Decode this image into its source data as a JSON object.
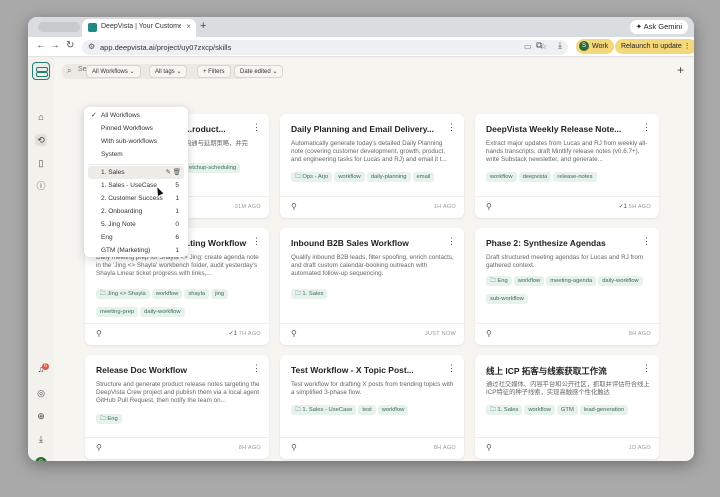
{
  "browser": {
    "tab_title": "DeepVista | Your Customer P...",
    "tab_close": "×",
    "new_tab": "+",
    "ask_gemini": "✦ Ask Gemini",
    "url": "app.deepvista.ai/project/uy07zxcp/skills",
    "profile_initial": "S",
    "profile_label": "Work",
    "relaunch": "Relaunch to update ⋮"
  },
  "sidebar": {
    "notifications_count": "6",
    "user_initial": "S"
  },
  "search": {
    "placeholder": "Search workflows..."
  },
  "filters": {
    "workflows": "All Workflows ⌄",
    "tags": "All tags ⌄",
    "add_filters": "+ Filters",
    "sort": "Date edited ⌄"
  },
  "dropdown": {
    "items": [
      {
        "label": "All Workflows",
        "checked": "✓"
      },
      {
        "label": "Pinned Workflows"
      },
      {
        "label": "With sub-workflows"
      },
      {
        "label": "System"
      },
      {
        "label": "1. Sales",
        "hover": true
      },
      {
        "label": "1. Sales - UseCase",
        "count": "5"
      },
      {
        "label": "2. Customer Success",
        "count": "1"
      },
      {
        "label": "2. Onboarding",
        "count": "1"
      },
      {
        "label": "5. Jing Note",
        "count": "0"
      },
      {
        "label": "Eng",
        "count": "6"
      },
      {
        "label": "GTM (Marketing)",
        "count": "1"
      }
    ]
  },
  "cards": [
    {
      "title": "...roduct...",
      "desc": "沟通与延期策略，并完",
      "tags": [
        "etchup-scheduling"
      ],
      "time": "31M AGO"
    },
    {
      "title": "Daily Planning and Email Delivery...",
      "desc": "Automatically generate today's detailed Daily Planning note (covering customer development, growth, product, and engineering tasks for Lucas and RJ) and email it t...",
      "tags": [
        "🗀 Ops - Arjo",
        "workflow",
        "daily-planning",
        "email"
      ],
      "time": "1H AGO"
    },
    {
      "title": "DeepVista Weekly Release Note...",
      "desc": "Extract major updates from Lucas and RJ from weekly all-hands transcripts, draft Mintlify release notes (v0.6.7+), write Substack newsletter, and generate...",
      "tags": [
        "workflow",
        "deepvista",
        "release-notes"
      ],
      "count": "✓1",
      "time": "5H AGO"
    },
    {
      "title": "...ting Workflow",
      "desc": "Daily meeting prep for Shayla <> Jing: create agenda note in the 'Jing <> Shayla' workbench folder, audit yesterday's Shayla Linear ticket progress with links,...",
      "tags": [
        "🗀 Jing <> Shayla",
        "workflow",
        "shayla",
        "jing",
        "meeting-prep",
        "daily-workflow"
      ],
      "count": "✓1",
      "time": "7H AGO"
    },
    {
      "title": "Inbound B2B Sales Workflow",
      "desc": "Qualify inbound B2B leads, filter spoofing, enrich contacts, and draft custom calendar-booking outreach with automated follow-up sequencing.",
      "tags": [
        "🗀 1. Sales"
      ],
      "time": "JUST NOW"
    },
    {
      "title": "Phase 2: Synthesize Agendas",
      "desc": "Draft structured meeting agendas for Lucas and RJ from gathered context.",
      "tags": [
        "🗀 Eng",
        "workflow",
        "meeting-agenda",
        "daily-workflow",
        "sub-workflow"
      ],
      "time": "8H AGO"
    },
    {
      "title": "Release Doc Workflow",
      "desc": "Structure and generate product release notes targeting the DeepVista Crew project and publish them via a local agent GitHub Pull Request, then notify the team on...",
      "tags": [
        "🗀 Eng"
      ],
      "time": "8H AGO"
    },
    {
      "title": "Test Workflow - X Topic Post...",
      "desc": "Test workflow for drafting X posts from trending topics with a simplified 3-phase flow.",
      "tags": [
        "🗀 1. Sales - UseCase",
        "test",
        "workflow"
      ],
      "time": "8H AGO"
    },
    {
      "title": "线上 ICP 拓客与线索获取工作流",
      "desc": "通过社交媒体、内容平台和公开社区，抓取并评估符合线上ICP特征的种子线索，实现高触感个性化触达",
      "tags": [
        "🗀 1. Sales",
        "workflow",
        "GTM",
        "lead-generation"
      ],
      "time": "1D AGO"
    }
  ]
}
